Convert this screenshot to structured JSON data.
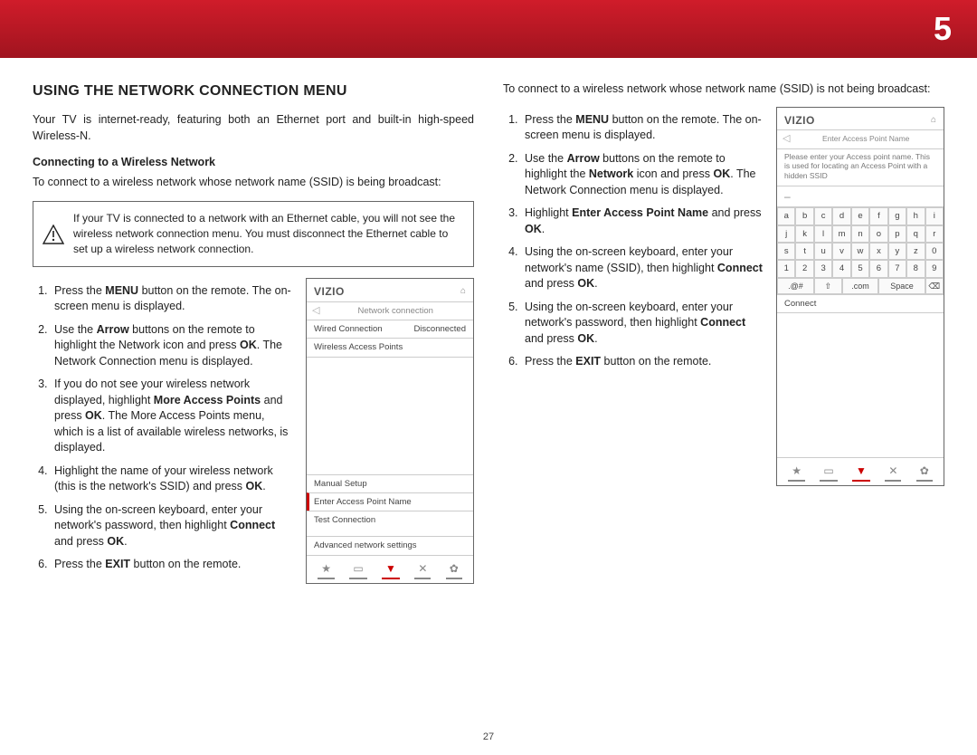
{
  "chapterNumber": "5",
  "pageNumber": "27",
  "section": {
    "title": "USING THE NETWORK CONNECTION MENU",
    "intro": "Your TV is internet-ready, featuring both an Ethernet port and built-in high-speed Wireless-N.",
    "subheading": "Connecting to a Wireless Network",
    "leadA": "To connect to a wireless network whose network name (SSID) is being broadcast:",
    "callout": "If your TV is connected to a network with an Ethernet cable, you will not see the wireless network connection menu. You must disconnect the Ethernet cable to set up a wireless network connection.",
    "stepsA": [
      "Press the <b>MENU</b> button on the remote. The on-screen menu is displayed.",
      "Use the <b>Arrow</b> buttons on the remote to highlight the Network icon and press <b>OK</b>. The Network Connection menu is displayed.",
      "If you do not see your wireless network displayed, highlight <b>More Access Points</b> and press <b>OK</b>. The More Access Points menu, which is a list of available wireless networks, is displayed.",
      "Highlight the name of your wireless network (this is the network's SSID) and press <b>OK</b>.",
      "Using the on-screen keyboard, enter your network's password, then highlight <b>Connect</b> and press <b>OK</b>.",
      "Press the <b>EXIT</b> button on the remote."
    ],
    "leadB": "To connect to a wireless network whose network name (SSID) is not being broadcast:",
    "stepsB": [
      "Press the <b>MENU</b> button on the remote. The on-screen menu is displayed.",
      "Use the <b>Arrow</b> buttons on the remote to highlight the <b>Network</b> icon and press <b>OK</b>. The Network Connection menu is displayed.",
      "Highlight <b>Enter Access Point Name</b> and press <b>OK</b>.",
      "Using the on-screen keyboard, enter your network's name (SSID), then highlight <b>Connect</b> and press <b>OK</b>.",
      "Using the on-screen keyboard, enter your network's password, then highlight <b>Connect</b> and press <b>OK</b>.",
      "Press the <b>EXIT</b> button on the remote."
    ]
  },
  "tvA": {
    "logo": "VIZIO",
    "title": "Network connection",
    "wiredLabel": "Wired Connection",
    "wiredStatus": "Disconnected",
    "wapLabel": "Wireless Access Points",
    "manualSetup": "Manual Setup",
    "enterAP": "Enter Access Point Name",
    "testConn": "Test Connection",
    "advanced": "Advanced network settings"
  },
  "tvB": {
    "logo": "VIZIO",
    "title": "Enter Access Point Name",
    "help": "Please enter your Access point name. This is used for locating an Access Point with a hidden SSID",
    "keys": [
      "a",
      "b",
      "c",
      "d",
      "e",
      "f",
      "g",
      "h",
      "i",
      "j",
      "k",
      "l",
      "m",
      "n",
      "o",
      "p",
      "q",
      "r",
      "s",
      "t",
      "u",
      "v",
      "w",
      "x",
      "y",
      "z",
      "0",
      "1",
      "2",
      "3",
      "4",
      "5",
      "6",
      "7",
      "8",
      "9"
    ],
    "symKey": ".@#",
    "shiftKey": "⇧",
    "comKey": ".com",
    "spaceKey": "Space",
    "delKey": "⌫",
    "connect": "Connect"
  },
  "icons": {
    "star": "★",
    "viv": "▭",
    "v": "▼",
    "x": "✕",
    "gear": "✿"
  }
}
